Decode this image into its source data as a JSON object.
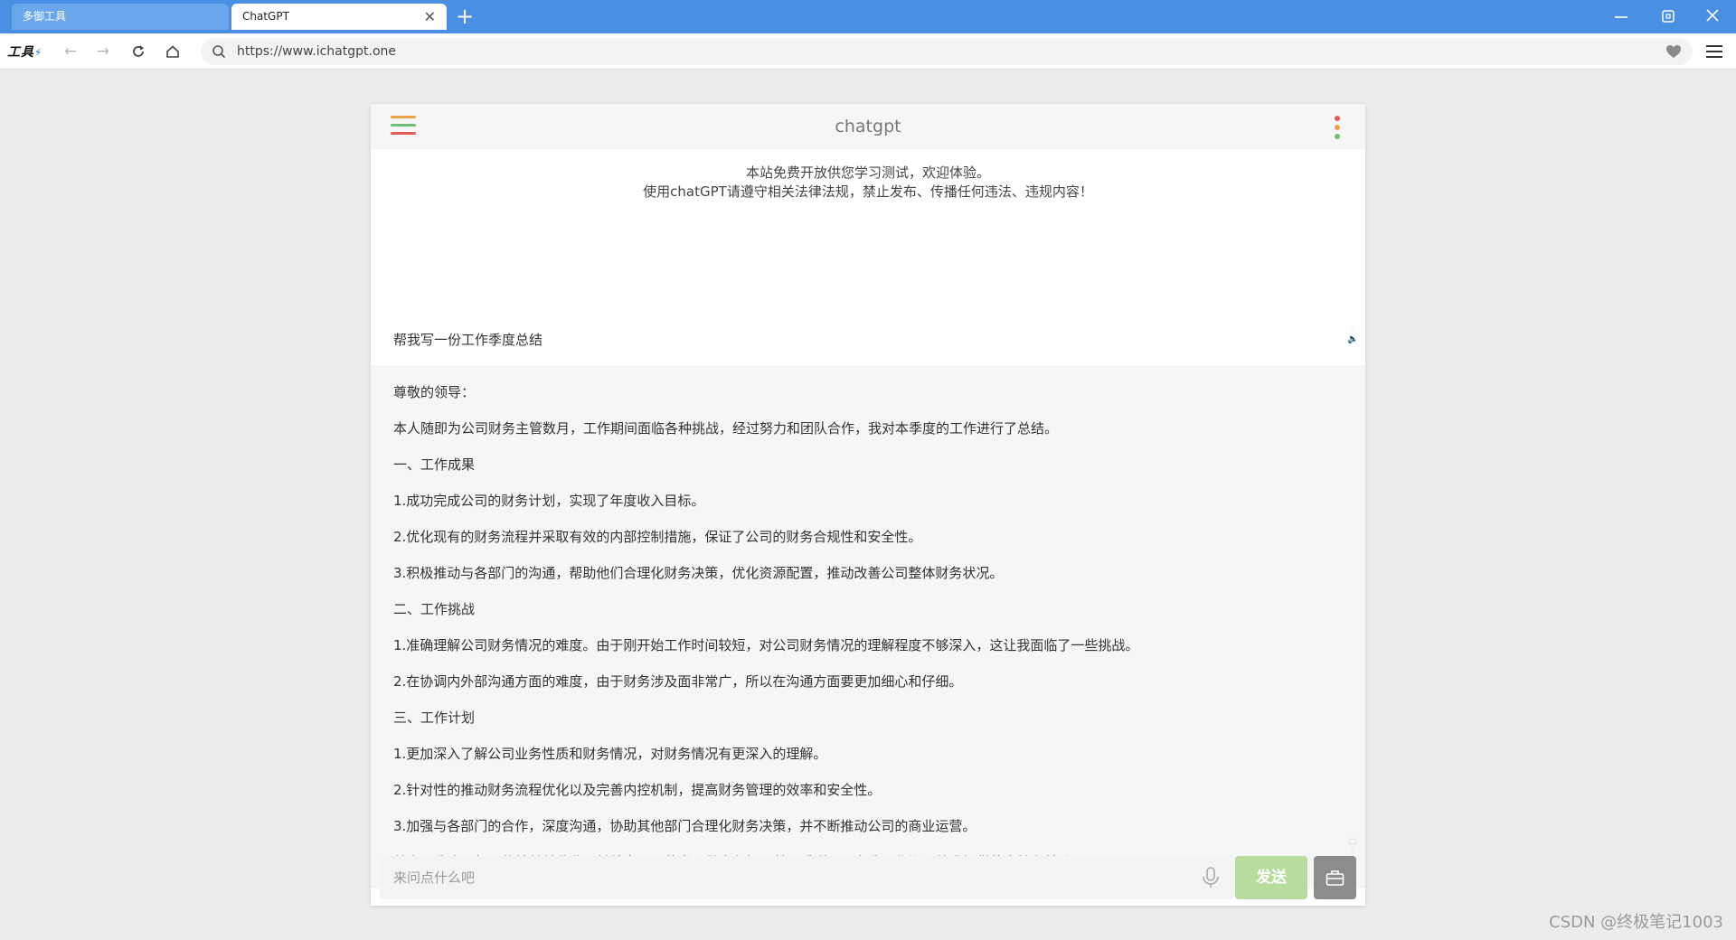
{
  "browser": {
    "tabs": [
      {
        "label": "多御工具",
        "active": false
      },
      {
        "label": "ChatGPT",
        "active": true
      }
    ],
    "brand": "工具",
    "url": "https://www.ichatgpt.one"
  },
  "chat": {
    "title": "chatgpt",
    "notice": [
      "本站免费开放供您学习测试，欢迎体验。",
      "使用chatGPT请遵守相关法律法规，禁止发布、传播任何违法、违规内容！"
    ],
    "user_message": "帮我写一份工作季度总结",
    "bot_lines": [
      "尊敬的领导：",
      "本人随即为公司财务主管数月，工作期间面临各种挑战，经过努力和团队合作，我对本季度的工作进行了总结。",
      "一、工作成果",
      "1.成功完成公司的财务计划，实现了年度收入目标。",
      "2.优化现有的财务流程并采取有效的内部控制措施，保证了公司的财务合规性和安全性。",
      "3.积极推动与各部门的沟通，帮助他们合理化财务决策，优化资源配置，推动改善公司整体财务状况。",
      "二、工作挑战",
      "1.准确理解公司财务情况的难度。由于刚开始工作时间较短，对公司财务情况的理解程度不够深入，这让我面临了一些挑战。",
      "2.在协调内外部沟通方面的难度，由于财务涉及面非常广，所以在沟通方面要更加细心和仔细。",
      "三、工作计划",
      "1.更加深入了解公司业务性质和财务情况，对财务情况有更深入的理解。",
      "2.针对性的推动财务流程优化以及完善内控机制，提高财务管理的效率和安全性。",
      "3.加强与各部门的合作，深度沟通，协助其他部门合理化财务决策，并不断推动公司的商业运营。",
      "总之，我会一如既往地兢兢业业、继续为公司的发展做出积极贡献，感谢公司在我工作期间给我提供的支持和鼓励。"
    ],
    "input": {
      "value": "",
      "placeholder": "来问点什么吧"
    },
    "send_label": "发送"
  },
  "watermark": "CSDN @终极笔记1003",
  "colors": {
    "titlebar": "#4a90e2",
    "send_button": "#b8dc9e",
    "hamburger": [
      "#f0a24a",
      "#6cc070",
      "#e45b5b"
    ],
    "kebab": [
      "#e45b5b",
      "#f0a24a",
      "#6cc070"
    ]
  }
}
